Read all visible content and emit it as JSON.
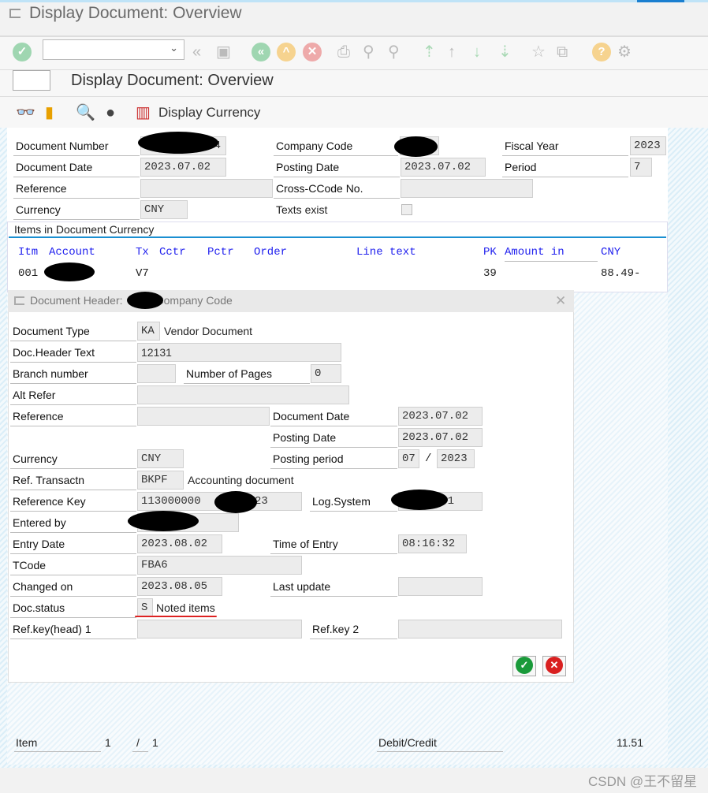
{
  "window": {
    "title": "Display Document: Overview"
  },
  "toolbar": {
    "command_field": "",
    "icons": [
      "enter-icon",
      "back-icon",
      "save-icon",
      "back-green-icon",
      "exit-icon",
      "cancel-icon",
      "print-icon",
      "find-icon",
      "find-next-icon",
      "first-page-icon",
      "previous-page-icon",
      "next-page-icon",
      "last-page-icon",
      "new-session-icon",
      "shortcut-icon",
      "help-icon",
      "settings-icon"
    ]
  },
  "screen": {
    "title": "Display Document: Overview"
  },
  "app_toolbar": {
    "display_currency": "Display Currency"
  },
  "header": {
    "document_number": {
      "label": "Document Number",
      "value": "4"
    },
    "company_code": {
      "label": "Company Code",
      "value": ""
    },
    "fiscal_year": {
      "label": "Fiscal Year",
      "value": "2023"
    },
    "document_date": {
      "label": "Document Date",
      "value": "2023.07.02"
    },
    "posting_date": {
      "label": "Posting Date",
      "value": "2023.07.02"
    },
    "period": {
      "label": "Period",
      "value": "7"
    },
    "reference": {
      "label": "Reference",
      "value": ""
    },
    "cross_ccode": {
      "label": "Cross-CCode No.",
      "value": ""
    },
    "currency": {
      "label": "Currency",
      "value": "CNY"
    },
    "texts_exist": {
      "label": "Texts exist",
      "checked": false
    }
  },
  "items": {
    "title": "Items in Document Currency",
    "columns": [
      "Itm",
      "Account",
      "Tx",
      "Cctr",
      "Pctr",
      "Order",
      "Line text",
      "PK",
      "Amount in",
      "CNY"
    ],
    "rows": [
      {
        "itm": "001",
        "account": "",
        "tx": "V7",
        "pk": "39",
        "amount": "88.49-"
      }
    ]
  },
  "dialog": {
    "title_prefix": "Document Header:",
    "title_suffix": "Company Code",
    "document_type": {
      "label": "Document Type",
      "value": "KA",
      "text": "Vendor Document"
    },
    "doc_header_text": {
      "label": "Doc.Header Text",
      "value": "12131"
    },
    "branch_number": {
      "label": "Branch number",
      "value": ""
    },
    "number_of_pages": {
      "label": "Number of Pages",
      "value": "0"
    },
    "alt_refer": {
      "label": "Alt Refer",
      "value": ""
    },
    "reference": {
      "label": "Reference",
      "value": ""
    },
    "document_date": {
      "label": "Document Date",
      "value": "2023.07.02"
    },
    "posting_date": {
      "label": "Posting Date",
      "value": "2023.07.02"
    },
    "currency": {
      "label": "Currency",
      "value": "CNY"
    },
    "posting_period": {
      "label": "Posting period",
      "month": "07",
      "sep": "/",
      "year": "2023"
    },
    "ref_transactn": {
      "label": "Ref. Transactn",
      "value": "BKPF",
      "text": "Accounting document"
    },
    "reference_key": {
      "label": "Reference Key",
      "value_start": "113000000",
      "value_end": "023"
    },
    "log_system": {
      "label": "Log.System",
      "value": "1"
    },
    "entered_by": {
      "label": "Entered by",
      "value": ""
    },
    "entry_date": {
      "label": "Entry Date",
      "value": "2023.08.02"
    },
    "time_of_entry": {
      "label": "Time of Entry",
      "value": "08:16:32"
    },
    "tcode": {
      "label": "TCode",
      "value": "FBA6"
    },
    "changed_on": {
      "label": "Changed on",
      "value": "2023.08.05"
    },
    "last_update": {
      "label": "Last update",
      "value": ""
    },
    "doc_status": {
      "label": "Doc.status",
      "value": "S",
      "text": "Noted items"
    },
    "ref_key_head1": {
      "label": "Ref.key(head) 1",
      "value": ""
    },
    "ref_key2": {
      "label": "Ref.key 2",
      "value": ""
    }
  },
  "footer": {
    "item_label": "Item",
    "item_current": "1",
    "sep": "/",
    "item_total": "1",
    "debit_credit_label": "Debit/Credit",
    "debit_credit_value": "11.51"
  },
  "watermark": "CSDN @王不留星",
  "colors": {
    "accent": "#1a8fd1",
    "column_header": "#2222ee",
    "highlight_underline": "#dd2222"
  }
}
